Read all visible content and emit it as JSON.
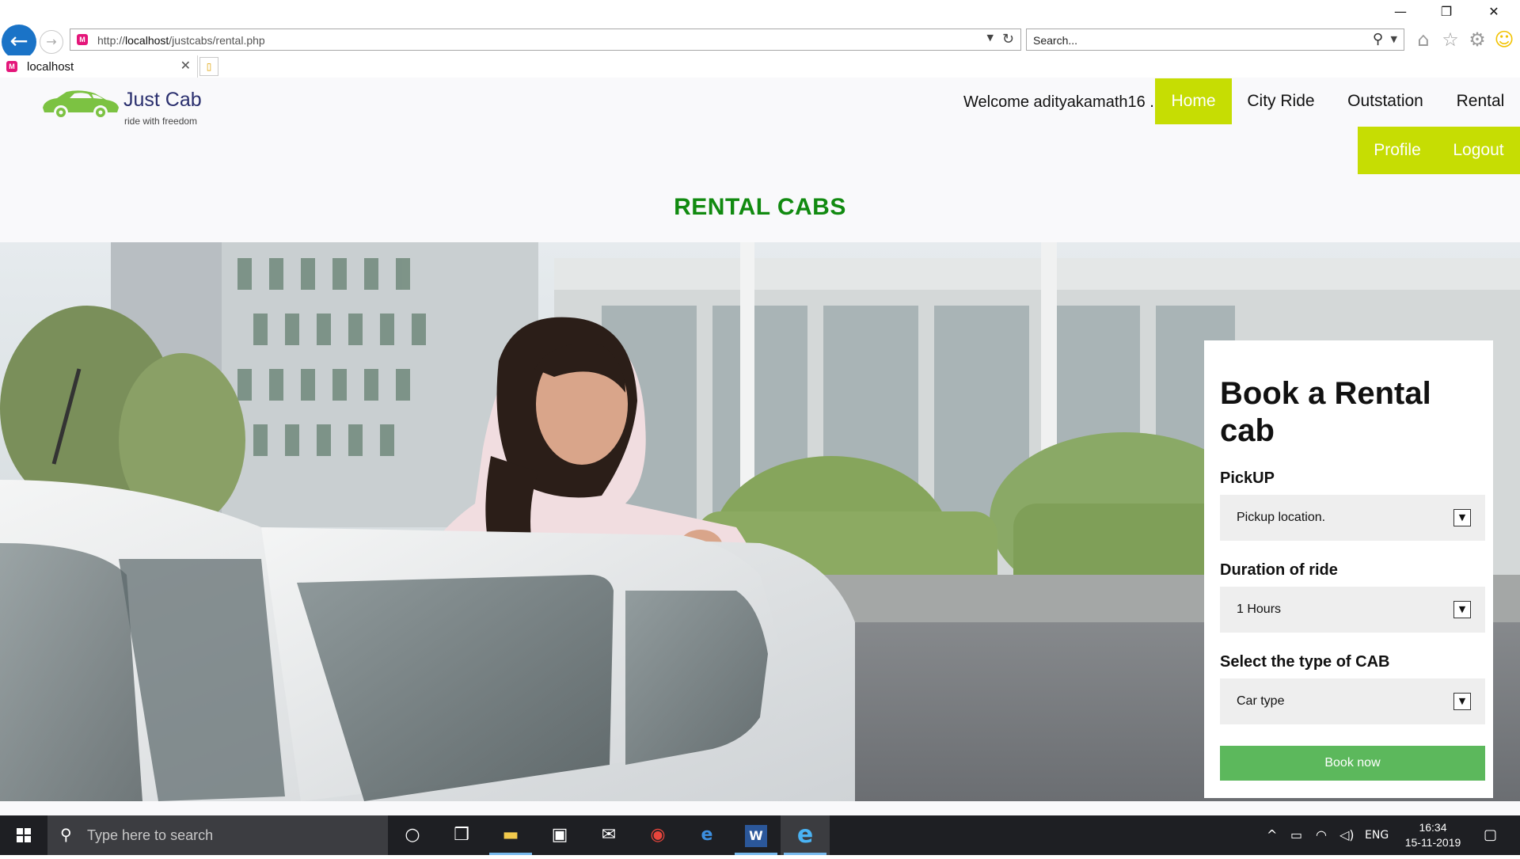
{
  "browser": {
    "window_controls": {
      "minimize": "—",
      "restore": "❐",
      "close": "✕"
    },
    "url_prefix": "http://",
    "url_host": "localhost",
    "url_path": "/justcabs/rental.php",
    "search_placeholder": "Search...",
    "tab_title": "localhost",
    "icons": [
      "back-icon",
      "forward-icon",
      "refresh-icon",
      "search-icon",
      "home-icon",
      "favorites-star-icon",
      "settings-gear-icon",
      "smiley-feedback-icon"
    ]
  },
  "site": {
    "logo_name": "Just Cab",
    "logo_tagline": "ride with freedom",
    "welcome": "Welcome adityakamath16 .",
    "nav": {
      "home": "Home",
      "city_ride": "City Ride",
      "outstation": "Outstation",
      "rental": "Rental",
      "profile": "Profile",
      "logout": "Logout"
    },
    "heading": "RENTAL CABS",
    "accent_color": "#c6dd03",
    "heading_color": "#118a10",
    "button_color": "#5cb85c"
  },
  "booking": {
    "title": "Book a Rental cab",
    "pickup_label": "PickUP",
    "pickup_value": "Pickup location.",
    "duration_label": "Duration of ride",
    "duration_value": "1 Hours",
    "cab_label": "Select the type of CAB",
    "cab_value": "Car type",
    "book_button": "Book now"
  },
  "taskbar": {
    "search_placeholder": "Type here to search",
    "apps": [
      "cortana-icon",
      "task-view-icon",
      "file-explorer-icon",
      "store-icon",
      "mail-icon",
      "chrome-icon",
      "edge-icon",
      "word-icon",
      "internet-explorer-icon"
    ],
    "language": "ENG",
    "time": "16:34",
    "date": "15-11-2019"
  }
}
